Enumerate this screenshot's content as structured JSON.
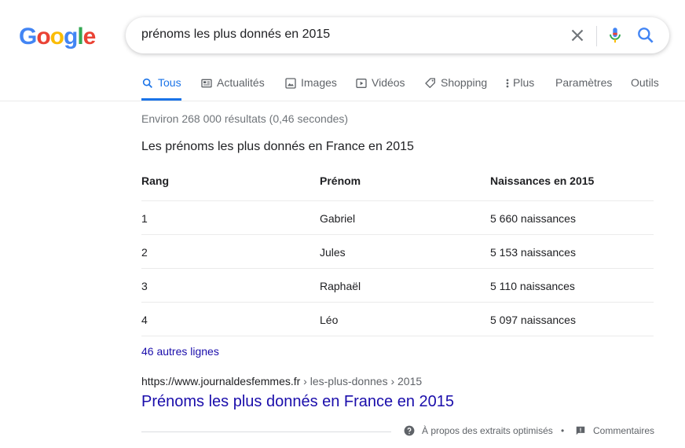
{
  "logo": {
    "letters": [
      "G",
      "o",
      "o",
      "g",
      "l",
      "e"
    ],
    "colors": [
      "#4285f4",
      "#ea4335",
      "#fbbc05",
      "#4285f4",
      "#34a853",
      "#ea4335"
    ]
  },
  "search": {
    "query": "prénoms les plus donnés en 2015",
    "icons": [
      "close-icon",
      "mic-icon",
      "search-icon"
    ]
  },
  "tabs": [
    {
      "label": "Tous",
      "icon": "search-icon",
      "active": true
    },
    {
      "label": "Actualités",
      "icon": "news-icon"
    },
    {
      "label": "Images",
      "icon": "image-icon"
    },
    {
      "label": "Vidéos",
      "icon": "video-icon"
    },
    {
      "label": "Shopping",
      "icon": "tag-icon"
    },
    {
      "label": "Plus",
      "icon": "more-vert-icon"
    },
    {
      "label": "Paramètres"
    },
    {
      "label": "Outils"
    }
  ],
  "stats": "Environ 268 000 résultats (0,46 secondes)",
  "snippet": {
    "title": "Les prénoms les plus donnés en France en 2015",
    "headers": [
      "Rang",
      "Prénom",
      "Naissances en 2015"
    ],
    "rows": [
      [
        "1",
        "Gabriel",
        "5 660 naissances"
      ],
      [
        "2",
        "Jules",
        "5 153 naissances"
      ],
      [
        "3",
        "Raphaël",
        "5 110 naissances"
      ],
      [
        "4",
        "Léo",
        "5 097 naissances"
      ]
    ],
    "more_link": "46 autres lignes"
  },
  "result": {
    "url_base": "https://www.journaldesfemmes.fr",
    "url_crumbs": " › les-plus-donnes › 2015",
    "title": "Prénoms les plus donnés en France en 2015"
  },
  "footer": {
    "about": "À propos des extraits optimisés",
    "separator": "•",
    "feedback": "Commentaires"
  },
  "colors": {
    "accent": "#1a73e8",
    "link": "#1a0dab"
  }
}
